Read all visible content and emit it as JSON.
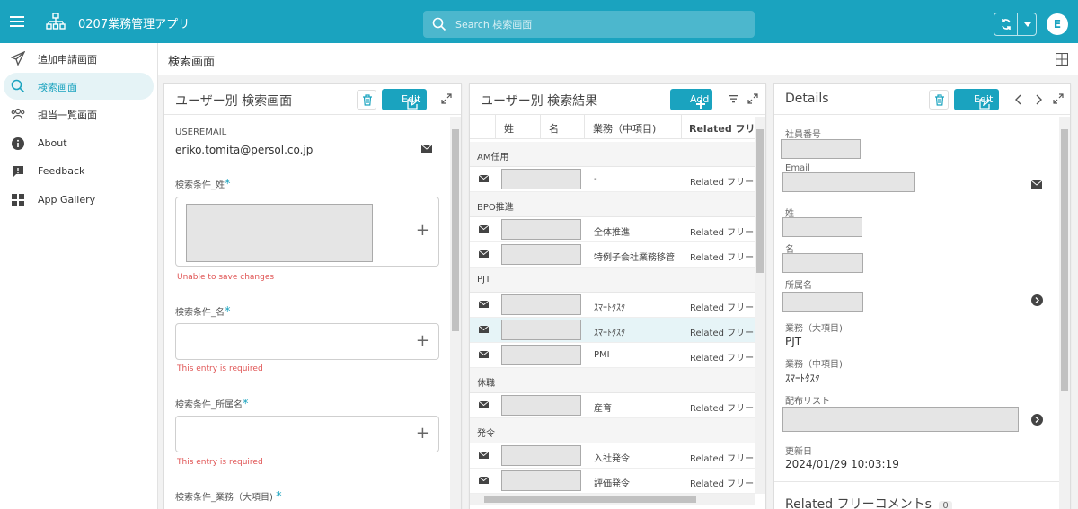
{
  "app": {
    "title": "0207業務管理アプリ",
    "search_placeholder": "Search 検索画面",
    "avatar_initial": "E",
    "brand_color": "#1aa3bf"
  },
  "sidebar": {
    "items": [
      {
        "label": "追加申請画面",
        "icon": "paper-plane-icon",
        "active": false
      },
      {
        "label": "検索画面",
        "icon": "search-icon",
        "active": true
      },
      {
        "label": "担当一覧画面",
        "icon": "users-icon",
        "active": false
      },
      {
        "label": "About",
        "icon": "info-icon",
        "active": false
      },
      {
        "label": "Feedback",
        "icon": "feedback-icon",
        "active": false
      },
      {
        "label": "App Gallery",
        "icon": "grid-icon",
        "active": false
      }
    ]
  },
  "page": {
    "title": "検索画面"
  },
  "form_panel": {
    "title": "ユーザー別 検索画面",
    "edit_label": "Edit",
    "useremail_label": "USEREMAIL",
    "useremail_value": "eriko.tomita@persol.co.jp",
    "fields": [
      {
        "label": "検索条件_姓",
        "error": "Unable to save changes"
      },
      {
        "label": "検索条件_名",
        "error": "This entry is required"
      },
      {
        "label": "検索条件_所属名",
        "error": "This entry is required"
      },
      {
        "label": "検索条件_業務（大項目)"
      }
    ],
    "required_mark": "*",
    "plus": "+"
  },
  "results_panel": {
    "title": "ユーザー別 検索結果",
    "add_label": "Add",
    "columns": [
      "姓",
      "名",
      "業務（中項目)",
      "Related フリーコ"
    ],
    "groups": [
      {
        "name": "AM任用",
        "rows": [
          {
            "task": "-",
            "related": "Related フリーコ"
          }
        ]
      },
      {
        "name": "BPO推進",
        "rows": [
          {
            "task": "全体推進",
            "related": "Related フリーコ"
          },
          {
            "task": "特例子会社業務移管",
            "related": "Related フリーコ"
          }
        ]
      },
      {
        "name": "PJT",
        "rows": [
          {
            "task": "ｽﾏｰﾄﾀｽｸ",
            "related": "Related フリーコ"
          },
          {
            "task": "ｽﾏｰﾄﾀｽｸ",
            "related": "Related フリーコ",
            "selected": true
          },
          {
            "task": "PMI",
            "related": "Related フリーコ"
          }
        ]
      },
      {
        "name": "休職",
        "rows": [
          {
            "task": "産育",
            "related": "Related フリーコ"
          }
        ]
      },
      {
        "name": "発令",
        "rows": [
          {
            "task": "入社発令",
            "related": "Related フリーコ"
          },
          {
            "task": "評価発令",
            "related": "Related フリーコ"
          }
        ]
      }
    ]
  },
  "details_panel": {
    "title": "Details",
    "edit_label": "Edit",
    "labels": {
      "employee_no": "社員番号",
      "email": "Email",
      "last_name": "姓",
      "first_name": "名",
      "department": "所属名",
      "task_major": "業務（大項目)",
      "task_middle": "業務（中項目)",
      "distribution": "配布リスト",
      "updated": "更新日"
    },
    "values": {
      "task_major": "PJT",
      "task_middle": "ｽﾏｰﾄﾀｽｸ",
      "updated": "2024/01/29 10:03:19"
    },
    "related_title": "Related フリーコメントs",
    "related_count": "0"
  }
}
